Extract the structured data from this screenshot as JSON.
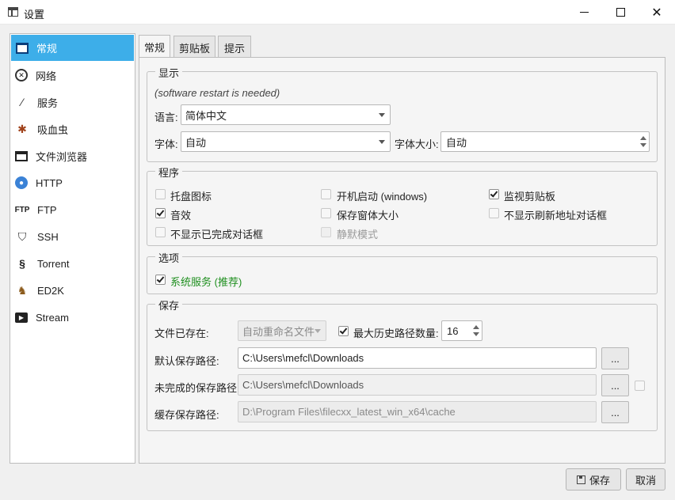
{
  "window": {
    "title": "设置"
  },
  "sidebar": {
    "items": [
      {
        "label": "常规",
        "icon": "general-icon"
      },
      {
        "label": "网络",
        "icon": "network-icon"
      },
      {
        "label": "服务",
        "icon": "wand-icon"
      },
      {
        "label": "吸血虫",
        "icon": "bug-icon"
      },
      {
        "label": "文件浏览器",
        "icon": "folder-icon"
      },
      {
        "label": "HTTP",
        "icon": "globe-icon"
      },
      {
        "label": "FTP",
        "icon": "ftp-icon"
      },
      {
        "label": "SSH",
        "icon": "shield-icon"
      },
      {
        "label": "Torrent",
        "icon": "torrent-icon"
      },
      {
        "label": "ED2K",
        "icon": "ed2k-icon"
      },
      {
        "label": "Stream",
        "icon": "stream-icon"
      }
    ]
  },
  "tabs": [
    "常规",
    "剪贴板",
    "提示"
  ],
  "display": {
    "title": "显示",
    "note": "(software restart is needed)",
    "language_label": "语言:",
    "language_value": "简体中文",
    "font_label": "字体:",
    "font_value": "自动",
    "font_size_label": "字体大小:",
    "font_size_value": "自动"
  },
  "program": {
    "title": "程序",
    "options": [
      {
        "label": "托盘图标",
        "checked": false
      },
      {
        "label": "开机启动 (windows)",
        "checked": false
      },
      {
        "label": "监视剪贴板",
        "checked": true
      },
      {
        "label": "音效",
        "checked": true
      },
      {
        "label": "保存窗体大小",
        "checked": false
      },
      {
        "label": "不显示刷新地址对话框",
        "checked": false
      },
      {
        "label": "不显示已完成对话框",
        "checked": false
      },
      {
        "label": "静默模式",
        "checked": false,
        "disabled": true
      }
    ]
  },
  "options": {
    "title": "选项",
    "system_service_label": "系统服务 (推荐)",
    "system_service_checked": true
  },
  "save": {
    "title": "保存",
    "file_exists_label": "文件已存在:",
    "file_exists_value": "自动重命名文件",
    "max_history_label": "最大历史路径数量:",
    "max_history_checked": true,
    "max_history_value": "16",
    "default_path_label": "默认保存路径:",
    "default_path_value": "C:\\Users\\mefcl\\Downloads",
    "incomplete_path_label": "未完成的保存路径:",
    "incomplete_path_value": "C:\\Users\\mefcl\\Downloads",
    "cache_path_label": "缓存保存路径:",
    "cache_path_value": "D:\\Program Files\\filecxx_latest_win_x64\\cache",
    "browse_label": "..."
  },
  "footer": {
    "save_label": "保存",
    "cancel_label": "取消"
  }
}
